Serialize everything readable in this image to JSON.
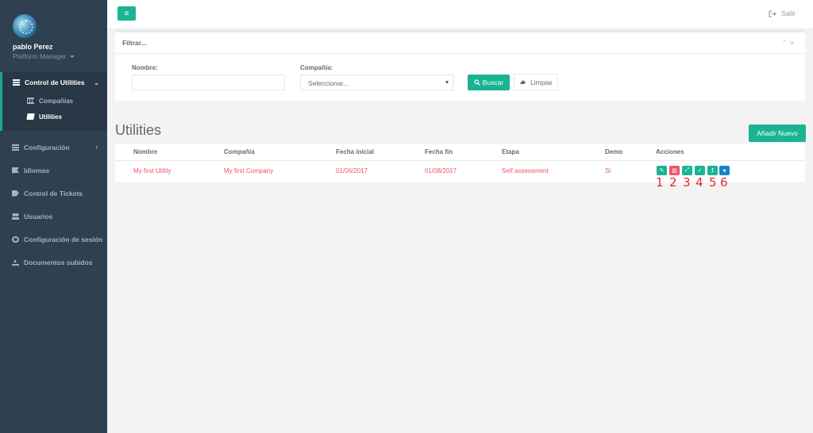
{
  "user": {
    "name": "pablo Perez",
    "role": "Platform Manager"
  },
  "nav": {
    "group": {
      "label": "Control de Utilities",
      "items": [
        {
          "label": "Compañías"
        },
        {
          "label": "Utilities"
        }
      ]
    },
    "items": [
      {
        "label": "Configuración"
      },
      {
        "label": "Idiomas"
      },
      {
        "label": "Control de Tickets"
      },
      {
        "label": "Usuarios"
      },
      {
        "label": "Configuración de sesión"
      },
      {
        "label": "Documentos subidos"
      }
    ]
  },
  "topbar": {
    "menu_icon": "≡",
    "logout_label": "Salir"
  },
  "filter": {
    "title": "Filtrar...",
    "nombre_label": "Nombre:",
    "nombre_value": "",
    "compania_label": "Compañía:",
    "compania_value": "Seleccionar...",
    "buscar_label": "Buscar",
    "limpiar_label": "Limpiar"
  },
  "page": {
    "title": "Utilities",
    "add_label": "Añadir Nuevo"
  },
  "table": {
    "headers": [
      "Nombre",
      "Compañía",
      "Fecha inicial",
      "Fecha fin",
      "Etapa",
      "Demo",
      "Acciones"
    ],
    "rows": [
      [
        "My first Utility",
        "My first Company",
        "01/06/2017",
        "01/08/2017",
        "Self assessment",
        "Si"
      ]
    ]
  },
  "action_numbers": [
    "1",
    "2",
    "3",
    "4",
    "5",
    "6"
  ],
  "colors": {
    "accent": "#1ab394",
    "danger": "#ed5565",
    "info": "#1c84c6",
    "sidebar": "#2f4050"
  }
}
